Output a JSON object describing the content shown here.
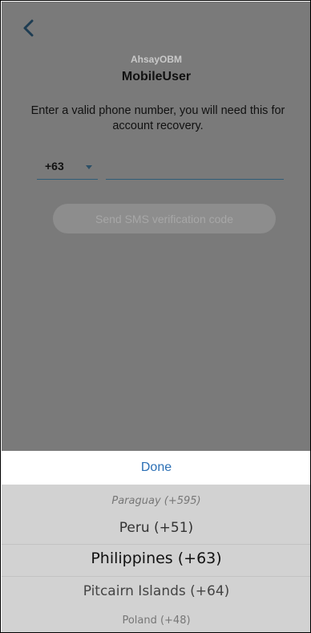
{
  "header": {
    "back_icon": "chevron-left-icon",
    "app_name": "AhsayOBM",
    "user_name": "MobileUser"
  },
  "form": {
    "instruction": "Enter a valid phone number, you will need this for account recovery.",
    "country_code": "+63",
    "phone_value": "",
    "send_button_label": "Send SMS verification code"
  },
  "picker": {
    "done_label": "Done",
    "options": [
      "Paraguay (+595)",
      "Peru (+51)",
      "Philippines (+63)",
      "Pitcairn Islands (+64)",
      "Poland (+48)"
    ],
    "selected": "Philippines (+63)"
  },
  "colors": {
    "overlay": "#7a7a7a",
    "accent": "#2b6fb5",
    "underline": "#2f5d77",
    "picker_bg": "#d2d2d2"
  }
}
